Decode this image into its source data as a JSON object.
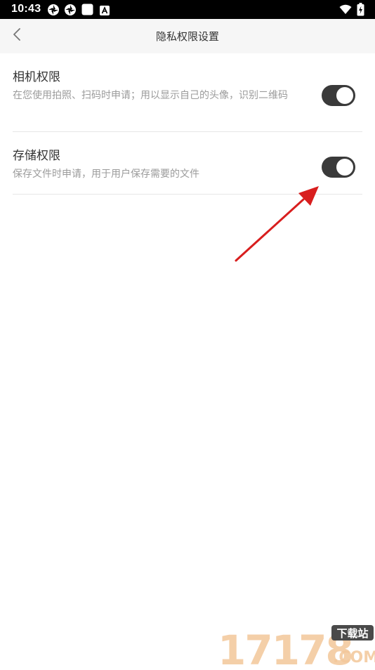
{
  "status_bar": {
    "time": "10:43",
    "left_icons": [
      "pinwheel-icon",
      "pinwheel-icon",
      "square-notification-icon",
      "a-notification-icon"
    ],
    "right_icons": [
      "wifi-icon",
      "battery-charging-icon"
    ]
  },
  "header": {
    "back_icon": "chevron-left-icon",
    "title": "隐私权限设置"
  },
  "permissions": [
    {
      "title": "相机权限",
      "description": "在您使用拍照、扫码时申请；用以显示自己的头像，识别二维码",
      "enabled": true
    },
    {
      "title": "存储权限",
      "description": "保存文件时申请，用于用户保存需要的文件",
      "enabled": true
    }
  ],
  "colors": {
    "toggle_on": "#3a3a3a",
    "header_bg": "#f6f6f6",
    "annotation_arrow": "#d81e1e"
  },
  "watermark": {
    "digits": "17178",
    "badge": "下载站",
    "domain": ".COM"
  }
}
